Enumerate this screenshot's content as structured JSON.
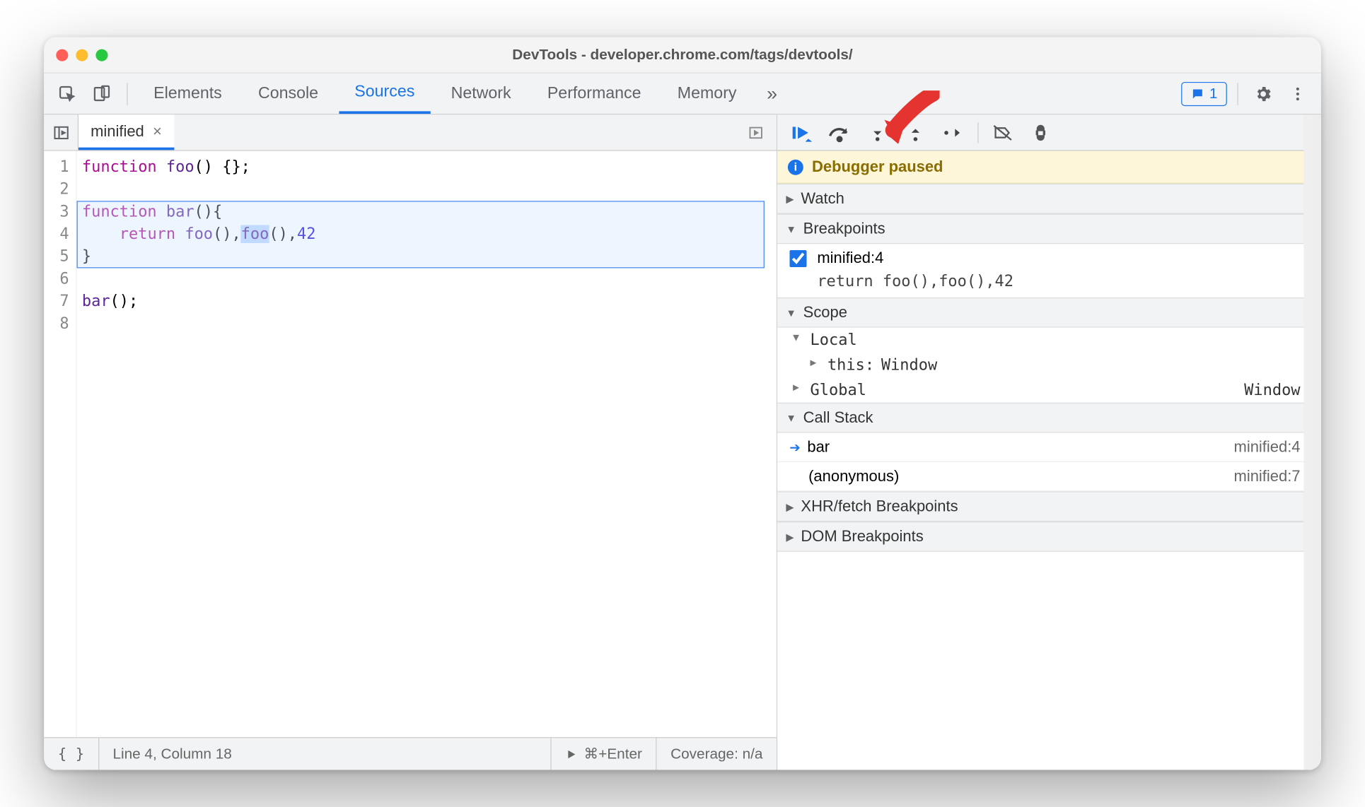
{
  "window": {
    "title": "DevTools - developer.chrome.com/tags/devtools/"
  },
  "tabs": [
    "Elements",
    "Console",
    "Sources",
    "Network",
    "Performance",
    "Memory"
  ],
  "activeTab": "Sources",
  "issues_pill": "1",
  "fileTab": {
    "name": "minified"
  },
  "code": {
    "lines": [
      {
        "n": "1",
        "segs": [
          [
            "kw",
            "function "
          ],
          [
            "fn",
            "foo"
          ],
          [
            "",
            "() {};"
          ]
        ]
      },
      {
        "n": "2",
        "segs": [
          [
            "",
            ""
          ]
        ]
      },
      {
        "n": "3",
        "segs": [
          [
            "kw",
            "function "
          ],
          [
            "fn",
            "bar"
          ],
          [
            "",
            "(){"
          ]
        ]
      },
      {
        "n": "4",
        "segs": [
          [
            "",
            "    "
          ],
          [
            "kw",
            "return"
          ],
          [
            "",
            " "
          ],
          [
            "fn",
            "foo"
          ],
          [
            "",
            "(),"
          ],
          [
            "sel fn",
            "foo"
          ],
          [
            "",
            "(),"
          ],
          [
            "num",
            "42"
          ]
        ]
      },
      {
        "n": "5",
        "segs": [
          [
            "",
            "}"
          ]
        ]
      },
      {
        "n": "6",
        "segs": [
          [
            "",
            ""
          ]
        ]
      },
      {
        "n": "7",
        "segs": [
          [
            "fn",
            "bar"
          ],
          [
            "",
            "();"
          ]
        ]
      },
      {
        "n": "8",
        "segs": [
          [
            "",
            ""
          ]
        ]
      }
    ],
    "highlight_line_index": 3
  },
  "status": {
    "pos": "Line 4, Column 18",
    "run_hint": "⌘+Enter",
    "coverage": "Coverage: n/a"
  },
  "debugger": {
    "banner": "Debugger paused",
    "sections": {
      "watch": "Watch",
      "breakpoints": "Breakpoints",
      "scope": "Scope",
      "callstack": "Call Stack",
      "xhr": "XHR/fetch Breakpoints",
      "dom": "DOM Breakpoints"
    },
    "breakpoint": {
      "label": "minified:4",
      "code": "return foo(),foo(),42"
    },
    "scope": {
      "local_label": "Local",
      "this_label": "this",
      "this_value": "Window",
      "global_label": "Global",
      "global_value": "Window"
    },
    "callstack": [
      {
        "fn": "bar",
        "loc": "minified:4",
        "current": true
      },
      {
        "fn": "(anonymous)",
        "loc": "minified:7",
        "current": false
      }
    ]
  }
}
